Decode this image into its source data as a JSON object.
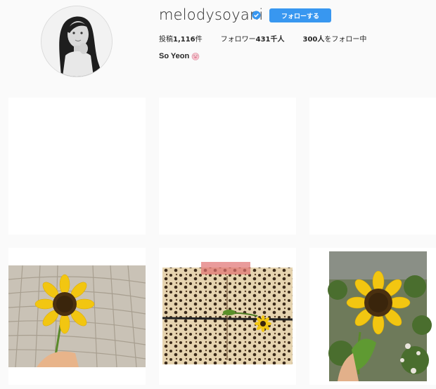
{
  "profile": {
    "username": "melodysoyani",
    "follow_label": "フォローする",
    "posts_label": "投稿",
    "posts_count": "1,116",
    "posts_unit": "件",
    "followers_label": "フォロワー",
    "followers_count": "431千人",
    "following_count": "300人",
    "following_label": "をフォロー中",
    "full_name": "So Yeon"
  },
  "colors": {
    "accent": "#3897f0",
    "background": "#fafafa",
    "tile": "#ffffff"
  },
  "icons": {
    "verified": "verified-badge-icon",
    "name_emoji": "pig-face-emoji-icon",
    "video": "video-camera-icon"
  }
}
